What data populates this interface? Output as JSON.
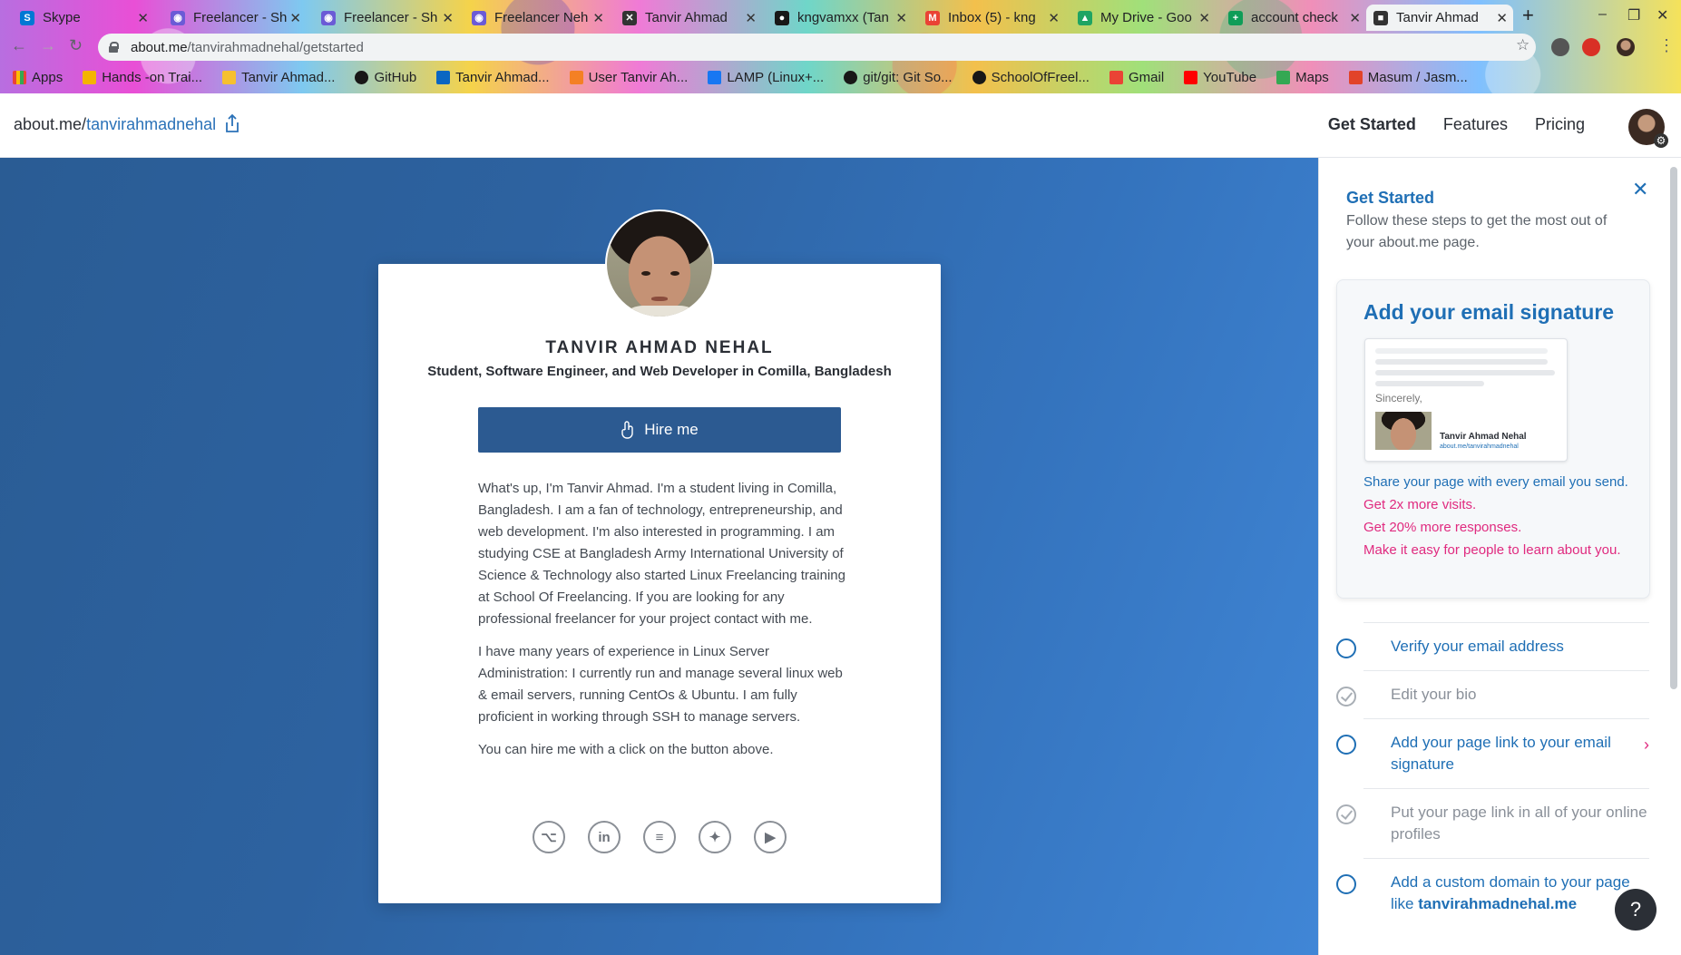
{
  "browser": {
    "tabs": [
      {
        "label": "Skype",
        "fav_color": "#0078d4",
        "fav_glyph": "S"
      },
      {
        "label": "Freelancer - Sh",
        "fav_color": "#6b5bd6",
        "fav_glyph": "◉"
      },
      {
        "label": "Freelancer - Sh",
        "fav_color": "#6b5bd6",
        "fav_glyph": "◉"
      },
      {
        "label": "Freelancer Neh",
        "fav_color": "#6b5bd6",
        "fav_glyph": "◉"
      },
      {
        "label": "Tanvir Ahmad",
        "fav_color": "#333333",
        "fav_glyph": "✕"
      },
      {
        "label": "kngvamxx (Tan",
        "fav_color": "#181717",
        "fav_glyph": "●"
      },
      {
        "label": "Inbox (5) - kng",
        "fav_color": "#ea4335",
        "fav_glyph": "M"
      },
      {
        "label": "My Drive - Goo",
        "fav_color": "#1fa463",
        "fav_glyph": "▲"
      },
      {
        "label": "account check",
        "fav_color": "#0f9d58",
        "fav_glyph": "+"
      },
      {
        "label": "Tanvir Ahmad",
        "fav_color": "#333333",
        "fav_glyph": "■"
      }
    ],
    "url": {
      "host": "about.me",
      "path": "/tanvirahmadnehal/getstarted"
    },
    "bookmarks": [
      {
        "label": "Apps",
        "color": "#ea4335"
      },
      {
        "label": "Hands -on Trai...",
        "color": "#f4b400"
      },
      {
        "label": "Tanvir Ahmad...",
        "color": "#f6c02f"
      },
      {
        "label": "GitHub",
        "color": "#181717"
      },
      {
        "label": "Tanvir Ahmad...",
        "color": "#0a66c2"
      },
      {
        "label": "User Tanvir Ah...",
        "color": "#f48024"
      },
      {
        "label": "LAMP (Linux+...",
        "color": "#1877f2"
      },
      {
        "label": "git/git: Git So...",
        "color": "#181717"
      },
      {
        "label": "SchoolOfFreel...",
        "color": "#181717"
      },
      {
        "label": "Gmail",
        "color": "#ea4335"
      },
      {
        "label": "YouTube",
        "color": "#ff0000"
      },
      {
        "label": "Maps",
        "color": "#34a853"
      },
      {
        "label": "Masum / Jasm...",
        "color": "#e24329"
      }
    ]
  },
  "site": {
    "url_prefix": "about.me/",
    "username": "tanvirahmadnehal",
    "nav": {
      "get_started": "Get Started",
      "features": "Features",
      "pricing": "Pricing"
    }
  },
  "profile": {
    "name": "TANVIR AHMAD NEHAL",
    "headline": "Student, Software Engineer, and Web Developer in Comilla, Bangladesh",
    "hire_label": "Hire me",
    "bio": [
      "What's up, I'm Tanvir Ahmad. I'm a student living in Comilla, Bangladesh. I am a fan of technology, entrepreneurship, and web development. I'm also interested in programming. I am studying CSE at Bangladesh Army International University of Science & Technology also started Linux Freelancing training at School Of Freelancing. If you are looking for any professional freelancer for your project contact with me.",
      "I have many years of experience in Linux Server Administration: I currently run and manage several linux web & email servers, running CentOs & Ubuntu. I am fully proficient in working through SSH to manage servers.",
      "You can hire me with a click on the button above."
    ],
    "socials": [
      {
        "name": "github",
        "glyph": "⌥"
      },
      {
        "name": "linkedin",
        "glyph": "in"
      },
      {
        "name": "stackoverflow",
        "glyph": "≡"
      },
      {
        "name": "twitter",
        "glyph": "✦"
      },
      {
        "name": "youtube",
        "glyph": "▶"
      }
    ]
  },
  "panel": {
    "title": "Get Started",
    "description": "Follow these steps to get the most out of your about.me page.",
    "signature": {
      "title": "Add your email signature",
      "sincerely": "Sincerely,",
      "sig_name": "Tanvir Ahmad Nehal",
      "sig_link": "about.me/tanvirahmadnehal",
      "lead": "Share your page with every email you send.",
      "benefits": [
        "Get 2x more visits.",
        "Get 20% more responses.",
        "Make it easy for people to learn about you."
      ]
    },
    "steps": [
      {
        "label": "Verify your email address",
        "done": false
      },
      {
        "label": "Edit your bio",
        "done": true
      },
      {
        "label": "Add your page link to your email signature",
        "done": false,
        "arrow": true
      },
      {
        "label": "Put your page link in all of your online profiles",
        "done": true
      },
      {
        "label": "Add a custom domain to your page like",
        "domain": "tanvirahmadnehal.me",
        "done": false
      }
    ],
    "help_label": "?"
  }
}
